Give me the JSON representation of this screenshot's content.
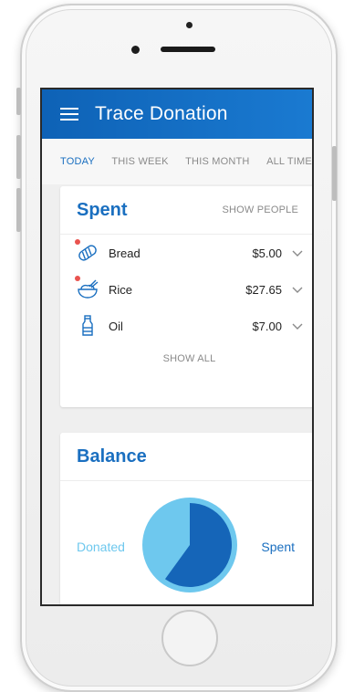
{
  "app": {
    "title": "Trace Donation"
  },
  "tabs": [
    {
      "label": "TODAY",
      "active": true
    },
    {
      "label": "THIS WEEK",
      "active": false
    },
    {
      "label": "THIS MONTH",
      "active": false
    },
    {
      "label": "ALL TIME",
      "active": false
    }
  ],
  "spent_card": {
    "title": "Spent",
    "show_people_label": "SHOW PEOPLE",
    "items": [
      {
        "name": "Bread",
        "amount": "$5.00",
        "icon": "bread-icon",
        "has_alert": true
      },
      {
        "name": "Rice",
        "amount": "$27.65",
        "icon": "rice-bowl-icon",
        "has_alert": true
      },
      {
        "name": "Oil",
        "amount": "$7.00",
        "icon": "oil-bottle-icon",
        "has_alert": false
      }
    ],
    "show_all_label": "SHOW ALL"
  },
  "balance_card": {
    "title": "Balance",
    "donated_label": "Donated",
    "spent_label": "Spent",
    "spent_fraction": 0.6
  },
  "colors": {
    "primary": "#1a6fc0",
    "appbar": "#1565c0",
    "donated_light": "#6ec8ee",
    "alert_red": "#e9534f",
    "muted_text": "#8a8a8a"
  }
}
